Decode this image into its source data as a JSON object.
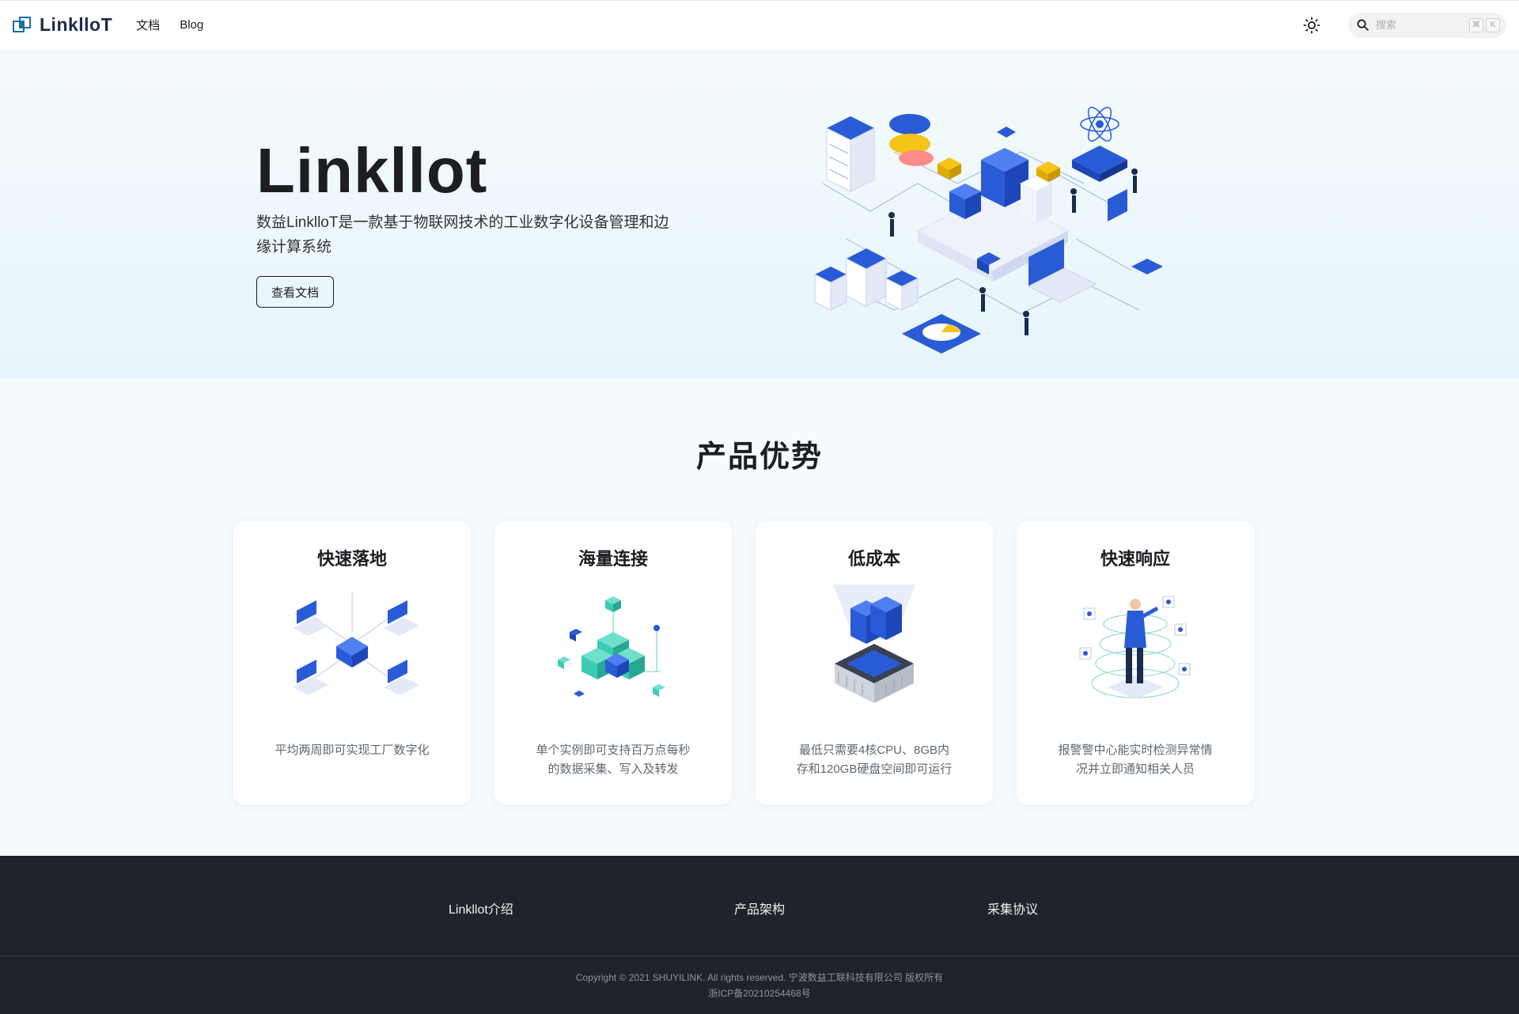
{
  "navbar": {
    "brand": "LinklloT",
    "links": [
      "文档",
      "Blog"
    ],
    "search_placeholder": "搜索",
    "kbd_keys": [
      "⌘",
      "K"
    ]
  },
  "hero": {
    "title": "Linkllot",
    "subtitle": "数益LinklloT是一款基于物联网技术的工业数字化设备管理和边缘计算系统",
    "button": "查看文档"
  },
  "advantages": {
    "title": "产品优势",
    "cards": [
      {
        "title": "快速落地",
        "desc": "平均两周即可实现工厂数字化"
      },
      {
        "title": "海量连接",
        "desc": "单个实例即可支持百万点每秒的数据采集、写入及转发"
      },
      {
        "title": "低成本",
        "desc": "最低只需要4核CPU、8GB内存和120GB硬盘空间即可运行"
      },
      {
        "title": "快速响应",
        "desc": "报警警中心能实时检测异常情况并立即通知相关人员"
      }
    ]
  },
  "footer": {
    "links": [
      "Linkllot介绍",
      "产品架构",
      "采集协议"
    ],
    "copyright": "Copyright © 2021 SHUYILINK. All rights reserved. 宁波数益工联科技有限公司 版权所有",
    "icp": "浙ICP备20210254468号"
  },
  "colors": {
    "brand_navy": "#1a2b4c",
    "accent_blue": "#2a5bd7",
    "accent_teal": "#3ccbb4",
    "accent_yellow": "#f5c518",
    "footer_bg": "#1f232b"
  }
}
